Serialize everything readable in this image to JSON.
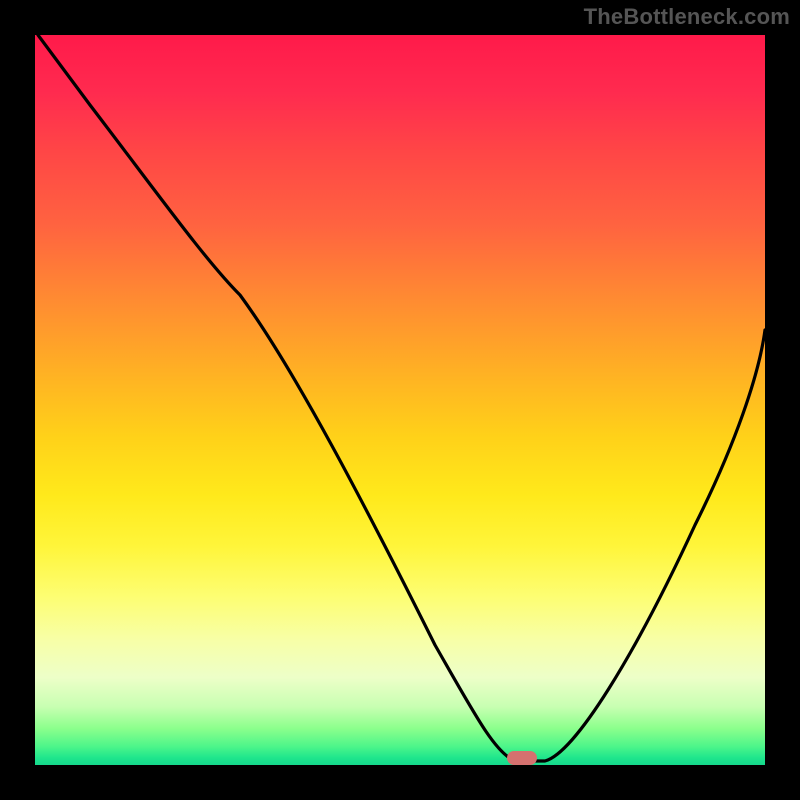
{
  "watermark": {
    "text": "TheBottleneck.com"
  },
  "chart_data": {
    "type": "line",
    "title": "",
    "xlabel": "",
    "ylabel": "",
    "xlim": [
      0,
      100
    ],
    "ylim": [
      0,
      100
    ],
    "x": [
      0,
      6,
      14,
      22,
      28,
      36,
      44,
      52,
      58,
      62,
      66,
      70,
      76,
      82,
      88,
      94,
      100
    ],
    "values": [
      100,
      92,
      82,
      72,
      66,
      53,
      38,
      23,
      11,
      5,
      1,
      0,
      4,
      14,
      28,
      44,
      62
    ],
    "gradient_stops": [
      {
        "pos": 0,
        "color": "#ff1a4a"
      },
      {
        "pos": 16,
        "color": "#ff4646"
      },
      {
        "pos": 36,
        "color": "#ff8a32"
      },
      {
        "pos": 55,
        "color": "#ffd119"
      },
      {
        "pos": 77,
        "color": "#fdfe73"
      },
      {
        "pos": 92,
        "color": "#c8ffb2"
      },
      {
        "pos": 100,
        "color": "#15d88c"
      }
    ],
    "marker": {
      "x_pct": 66,
      "y_pct": 0,
      "color": "#d5716f"
    }
  }
}
